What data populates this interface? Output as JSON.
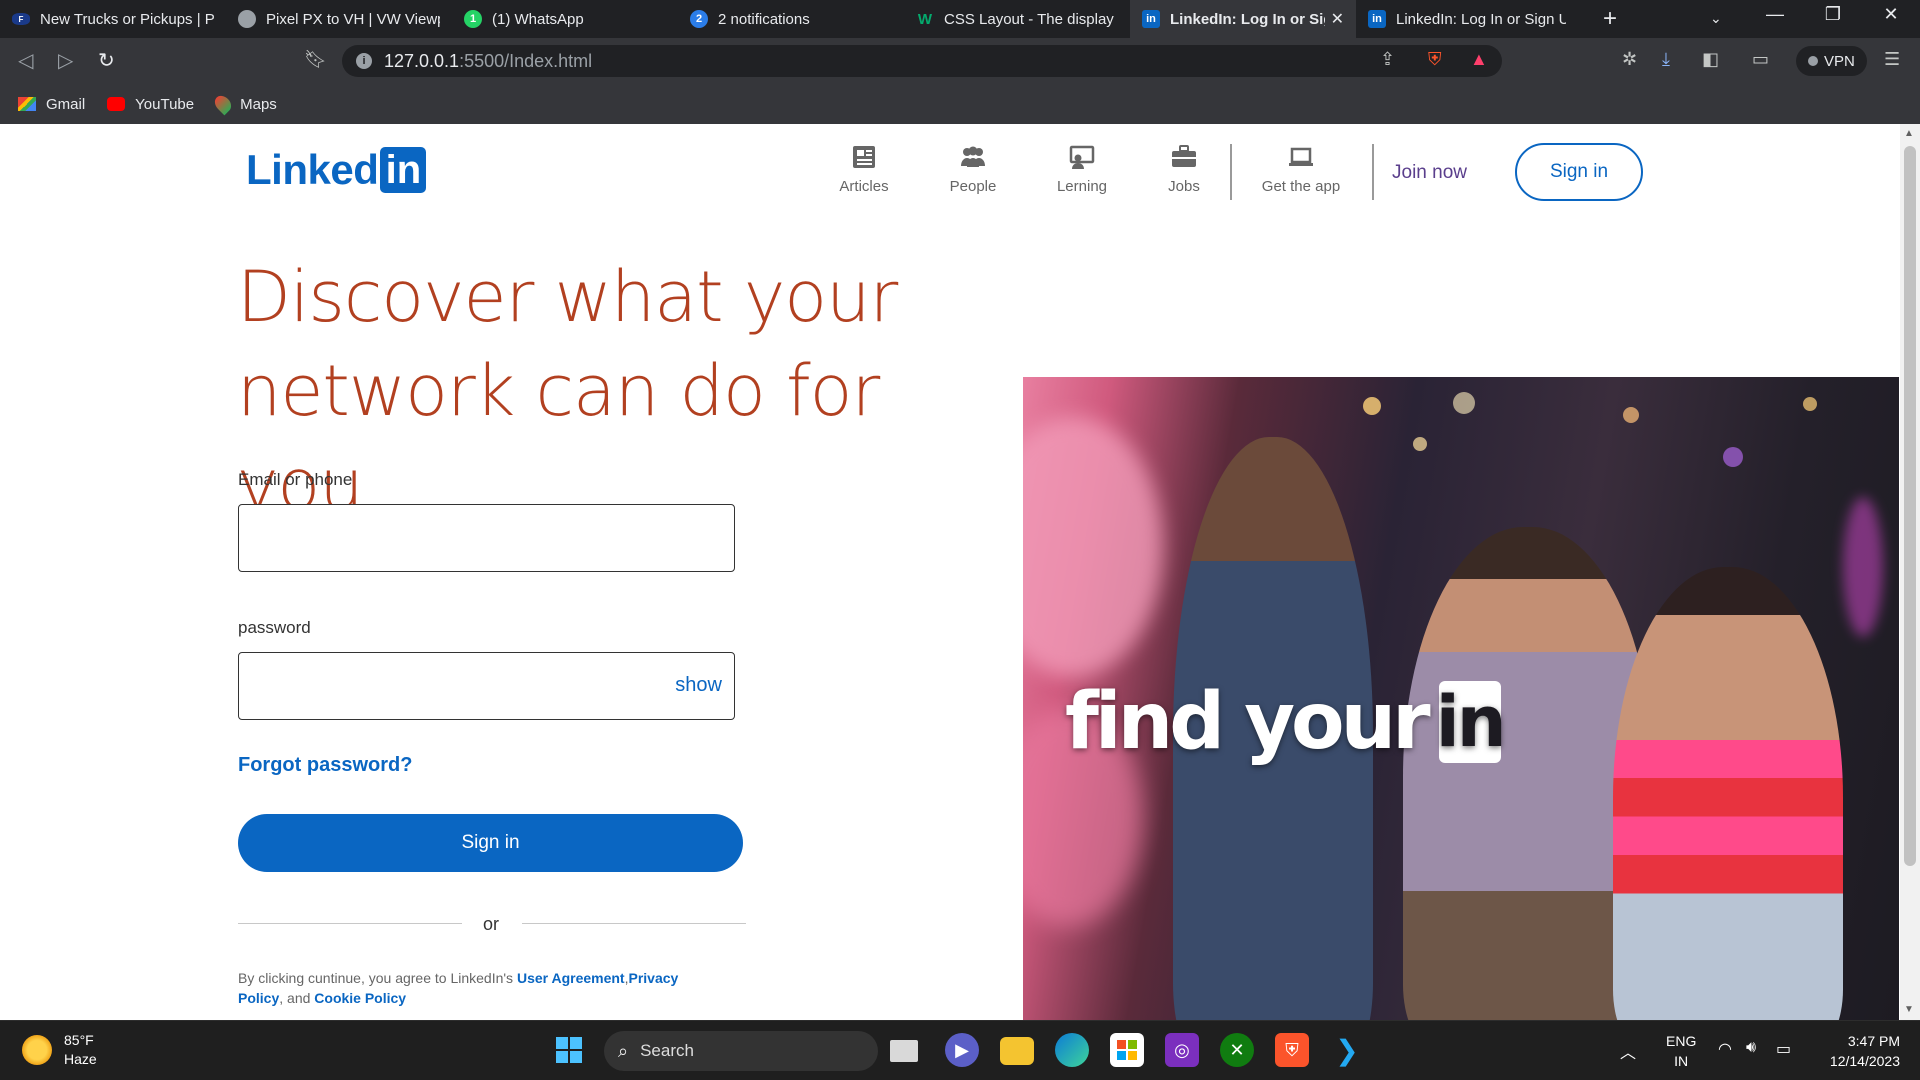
{
  "browser": {
    "tabs": [
      {
        "title": "New Trucks or Pickups | Pic",
        "icon": "ford-icon",
        "active": false
      },
      {
        "title": "Pixel PX to VH | VW Viewpo",
        "icon": "chrome-icon",
        "active": false
      },
      {
        "title": "(1) WhatsApp",
        "icon": "whatsapp-icon",
        "active": false
      },
      {
        "title": "2 notifications",
        "icon": "notification-icon",
        "badge": "2",
        "active": false
      },
      {
        "title": "CSS Layout - The display Pr",
        "icon": "w3schools-icon",
        "active": false
      },
      {
        "title": "LinkedIn: Log In or Sig",
        "icon": "linkedin-icon",
        "active": true
      },
      {
        "title": "LinkedIn: Log In or Sign Up",
        "icon": "linkedin-icon",
        "active": false
      }
    ],
    "url_host": "127.0.0.1",
    "url_path": ":5500/Index.html",
    "vpn_label": "VPN",
    "shield_badge": "1",
    "bookmarks": [
      {
        "label": "Gmail",
        "icon": "gmail-icon"
      },
      {
        "label": "YouTube",
        "icon": "youtube-icon"
      },
      {
        "label": "Maps",
        "icon": "maps-icon"
      }
    ]
  },
  "page": {
    "logo_text": "Linked",
    "logo_box": "in",
    "nav": [
      {
        "label": "Articles",
        "icon": "articles-icon"
      },
      {
        "label": "People",
        "icon": "people-icon"
      },
      {
        "label": "Lerning",
        "icon": "learning-icon"
      },
      {
        "label": "Jobs",
        "icon": "jobs-icon"
      },
      {
        "label": "Get the app",
        "icon": "laptop-icon"
      }
    ],
    "join_now": "Join now",
    "header_signin": "Sign in",
    "headline_line1": "Discover what your",
    "headline_line2": "network can do for you",
    "email_label": "Email or phone",
    "email_value": "",
    "password_label": "password",
    "password_value": "",
    "show_label": "show",
    "forgot_label": "Forgot password?",
    "signin_button": "Sign in",
    "or_text": "or",
    "legal_prefix": "By clicking cuntinue, you agree to LinkedIn's ",
    "legal_user_agreement": "User Agreement",
    "legal_privacy_a": "Privacy",
    "legal_privacy_b": "Policy",
    "legal_and": ", and ",
    "legal_cookie": "Cookie Policy",
    "hero_text": "find your",
    "hero_in": "in"
  },
  "taskbar": {
    "weather_temp": "85°F",
    "weather_cond": "Haze",
    "search_label": "Search",
    "lang_line1": "ENG",
    "lang_line2": "IN",
    "time": "3:47 PM",
    "date": "12/14/2023"
  },
  "colors": {
    "linkedin_blue": "#0a66c2",
    "headline": "#b24020",
    "chrome_dark": "#202124"
  }
}
